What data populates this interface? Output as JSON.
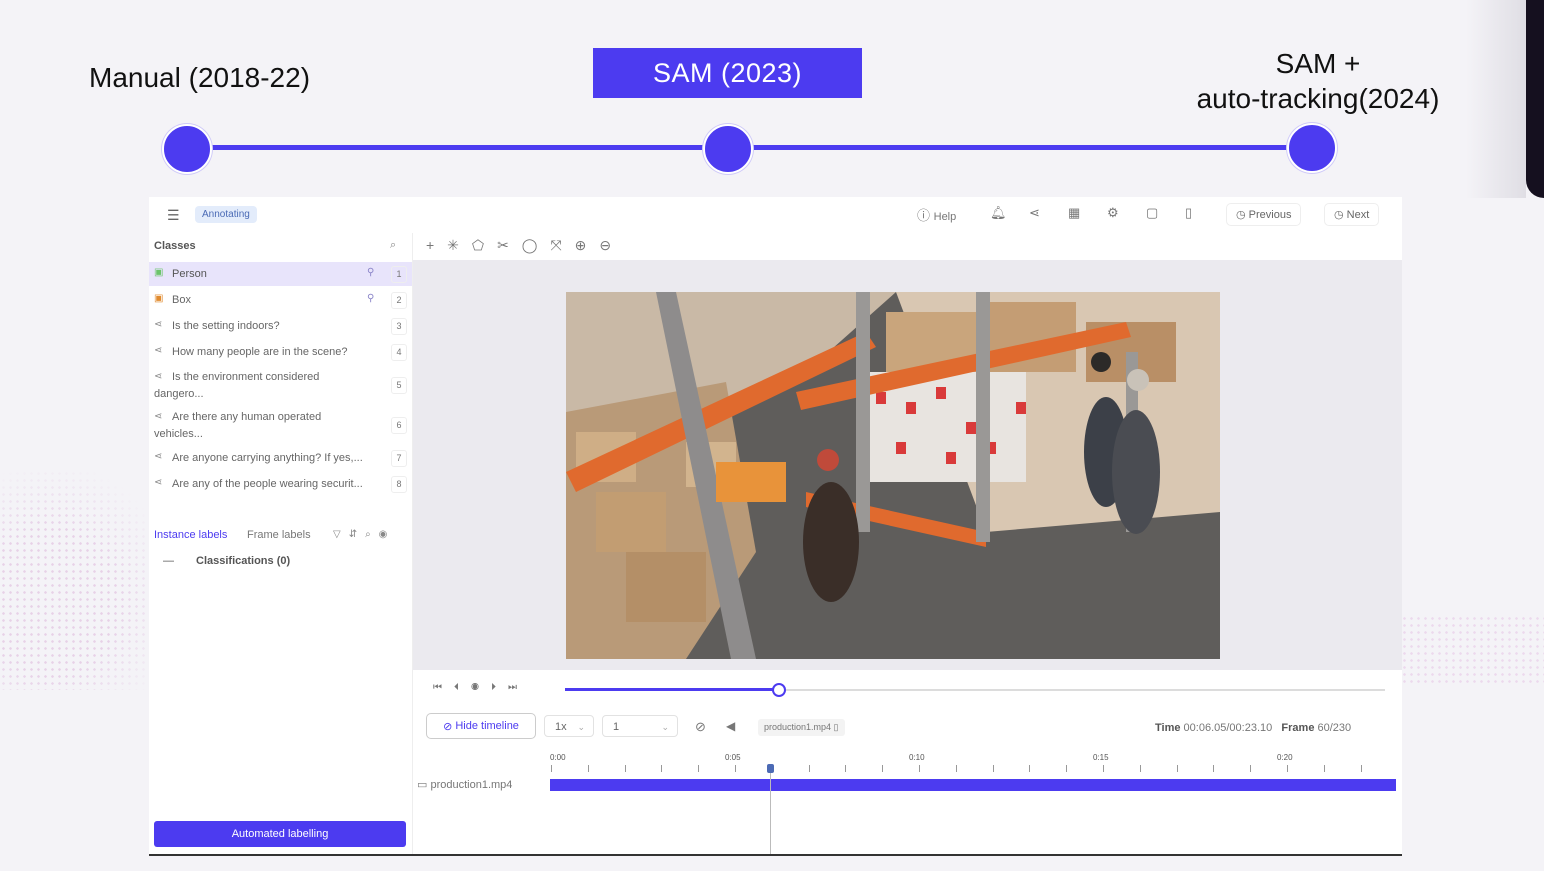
{
  "timeline": {
    "stage1": "Manual (2018-22)",
    "stage2": "SAM (2023)",
    "stage3_line1": "SAM +",
    "stage3_line2": "auto-tracking(2024)"
  },
  "app": {
    "status_badge": "Annotating",
    "topbar": {
      "help_label": "Help",
      "previous_label": "Previous",
      "next_label": "Next"
    },
    "sidebar": {
      "header": "Classes",
      "classes": [
        {
          "label": "Person",
          "num": "1",
          "color": "#6bc46b"
        },
        {
          "label": "Box",
          "num": "2",
          "color": "#e08a2e"
        },
        {
          "label": "Is the setting indoors?",
          "num": "3"
        },
        {
          "label": "How many people are in the scene?",
          "num": "4"
        },
        {
          "label": "Is the environment considered dangero...",
          "num": "5"
        },
        {
          "label": "Are there any human operated vehicles...",
          "num": "6"
        },
        {
          "label": "Are anyone carrying anything? If yes,...",
          "num": "7"
        },
        {
          "label": "Are any of the people wearing securit...",
          "num": "8"
        }
      ],
      "tab_instance": "Instance labels",
      "tab_frame": "Frame labels",
      "classifications": "Classifications (0)",
      "automated_button": "Automated labelling"
    },
    "player": {
      "hide_timeline": "Hide timeline",
      "speed": "1x",
      "frame_step": "1",
      "video_name": "production1.mp4",
      "time_label": "Time",
      "time_value": "00:06.05/00:23.10",
      "frame_label": "Frame",
      "frame_value": "60/230",
      "progress_fraction": 0.26,
      "ruler": [
        "0:00",
        "0:05",
        "0:10",
        "0:15",
        "0:20"
      ],
      "track_name": "production1.mp4"
    },
    "accent_color": "#4c3bf0"
  }
}
